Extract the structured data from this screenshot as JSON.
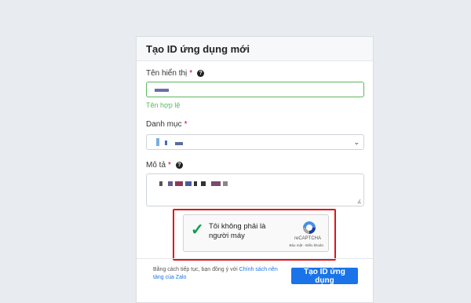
{
  "form": {
    "title": "Tạo ID ứng dụng mới",
    "display_name": {
      "label": "Tên hiển thị",
      "valid_text": "Tên hợp lệ"
    },
    "category": {
      "label": "Danh mục"
    },
    "description": {
      "label": "Mô tả"
    },
    "required_mark": "*",
    "help_glyph": "?"
  },
  "captcha": {
    "label": "Tôi không phải là người máy",
    "brand": "reCAPTCHA",
    "links": "Bảo mật - Điều khoản",
    "check_glyph": "✓"
  },
  "terms": {
    "prefix": "Bằng cách tiếp tục, bạn đồng ý với",
    "link": "Chính sách nền tảng của Zalo"
  },
  "submit_label": "Tạo ID ứng dụng",
  "colors": {
    "accent": "#1a73e8",
    "valid": "#5cb85c",
    "required": "#d0021b",
    "highlight": "#e0141a"
  },
  "icons": [
    "help-icon",
    "chevron-down-icon",
    "checkmark-icon",
    "recaptcha-logo-icon"
  ]
}
